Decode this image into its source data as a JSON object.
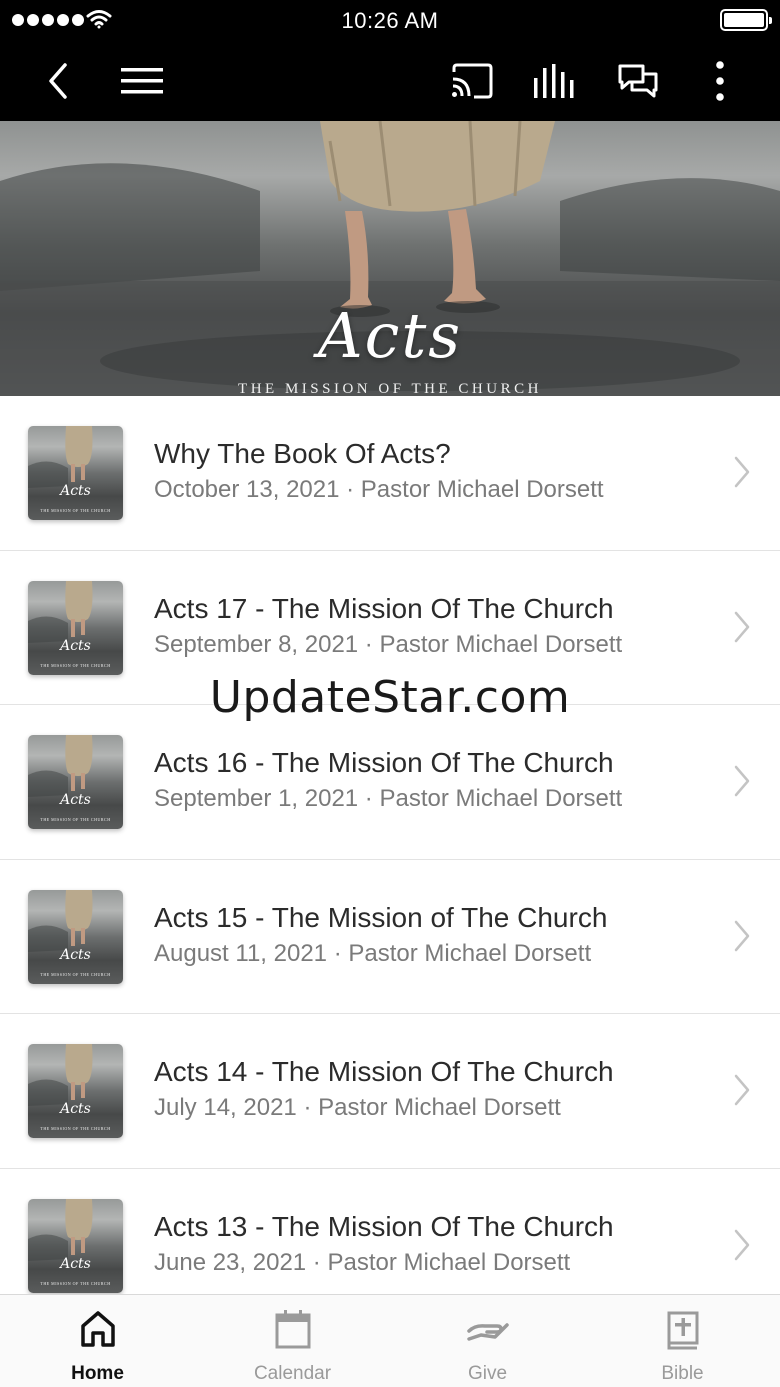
{
  "status_bar": {
    "time": "10:26 AM"
  },
  "hero": {
    "title": "Acts",
    "subtitle": "THE MISSION OF THE CHURCH"
  },
  "sermons": [
    {
      "title": "Why The Book Of Acts?",
      "meta": "October 13, 2021 · Pastor Michael Dorsett",
      "thumb_title": "Acts",
      "thumb_subtitle": "THE MISSION OF THE CHURCH"
    },
    {
      "title": "Acts 17 - The Mission Of The Church",
      "meta": "September 8, 2021 · Pastor Michael Dorsett",
      "thumb_title": "Acts",
      "thumb_subtitle": "THE MISSION OF THE CHURCH"
    },
    {
      "title": "Acts 16 - The Mission Of The Church",
      "meta": "September 1, 2021 · Pastor Michael Dorsett",
      "thumb_title": "Acts",
      "thumb_subtitle": "THE MISSION OF THE CHURCH"
    },
    {
      "title": "Acts 15 - The Mission of The Church",
      "meta": "August 11, 2021 · Pastor Michael Dorsett",
      "thumb_title": "Acts",
      "thumb_subtitle": "THE MISSION OF THE CHURCH"
    },
    {
      "title": "Acts 14 - The Mission Of The Church",
      "meta": "July 14, 2021 · Pastor Michael Dorsett",
      "thumb_title": "Acts",
      "thumb_subtitle": "THE MISSION OF THE CHURCH"
    },
    {
      "title": "Acts 13 - The Mission Of The Church",
      "meta": "June 23, 2021 · Pastor Michael Dorsett",
      "thumb_title": "Acts",
      "thumb_subtitle": "THE MISSION OF THE CHURCH"
    }
  ],
  "watermark": "UpdateStar.com",
  "tabs": [
    {
      "label": "Home",
      "icon": "home-icon",
      "active": true
    },
    {
      "label": "Calendar",
      "icon": "calendar-icon",
      "active": false
    },
    {
      "label": "Give",
      "icon": "give-icon",
      "active": false
    },
    {
      "label": "Bible",
      "icon": "bible-icon",
      "active": false
    }
  ],
  "colors": {
    "bar_background": "#000000",
    "active_tab": "#111111",
    "inactive_tab": "#9a9a9a"
  }
}
